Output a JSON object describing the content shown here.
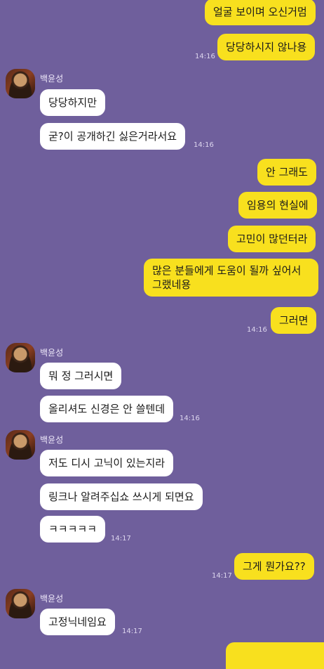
{
  "messages": [
    {
      "side": "me",
      "text": "얼굴 보이며 오신거멈"
    },
    {
      "side": "me",
      "text": "당당하시지 않나용",
      "time": "14:16"
    },
    {
      "side": "other",
      "sender": "백윤성",
      "text": "당당하지만"
    },
    {
      "side": "other",
      "text": "굳?이 공개하긴 싫은거라서요",
      "time": "14:16"
    },
    {
      "side": "me",
      "text": "안 그래도"
    },
    {
      "side": "me",
      "text": "임용의 현실에"
    },
    {
      "side": "me",
      "text": "고민이 많던터라"
    },
    {
      "side": "me",
      "text_line1": "많은 분들에게 도움이 될까 싶어서",
      "text_line2": "그랬네용"
    },
    {
      "side": "me",
      "text": "그러면",
      "time": "14:16"
    },
    {
      "side": "other",
      "sender": "백윤성",
      "text": "뭐 정 그러시면"
    },
    {
      "side": "other",
      "text": "올리셔도 신경은 안 쓸텐데",
      "time": "14:16"
    },
    {
      "side": "other",
      "sender": "백윤성",
      "text": "저도 디시 고닉이 있는지라"
    },
    {
      "side": "other",
      "text": "링크나 알려주십쇼 쓰시게 되면요"
    },
    {
      "side": "other",
      "text": "ㅋㅋㅋㅋㅋ",
      "time": "14:17"
    },
    {
      "side": "me",
      "text": "그게 뭔가요??",
      "time": "14:17"
    },
    {
      "side": "other",
      "sender": "백윤성",
      "text": "고정닉네임요",
      "time": "14:17"
    }
  ],
  "colors": {
    "background": "#6f5f9c",
    "my_bubble": "#f8e01e",
    "their_bubble": "#ffffff"
  },
  "icons": {
    "avatar": "profile-photo"
  }
}
